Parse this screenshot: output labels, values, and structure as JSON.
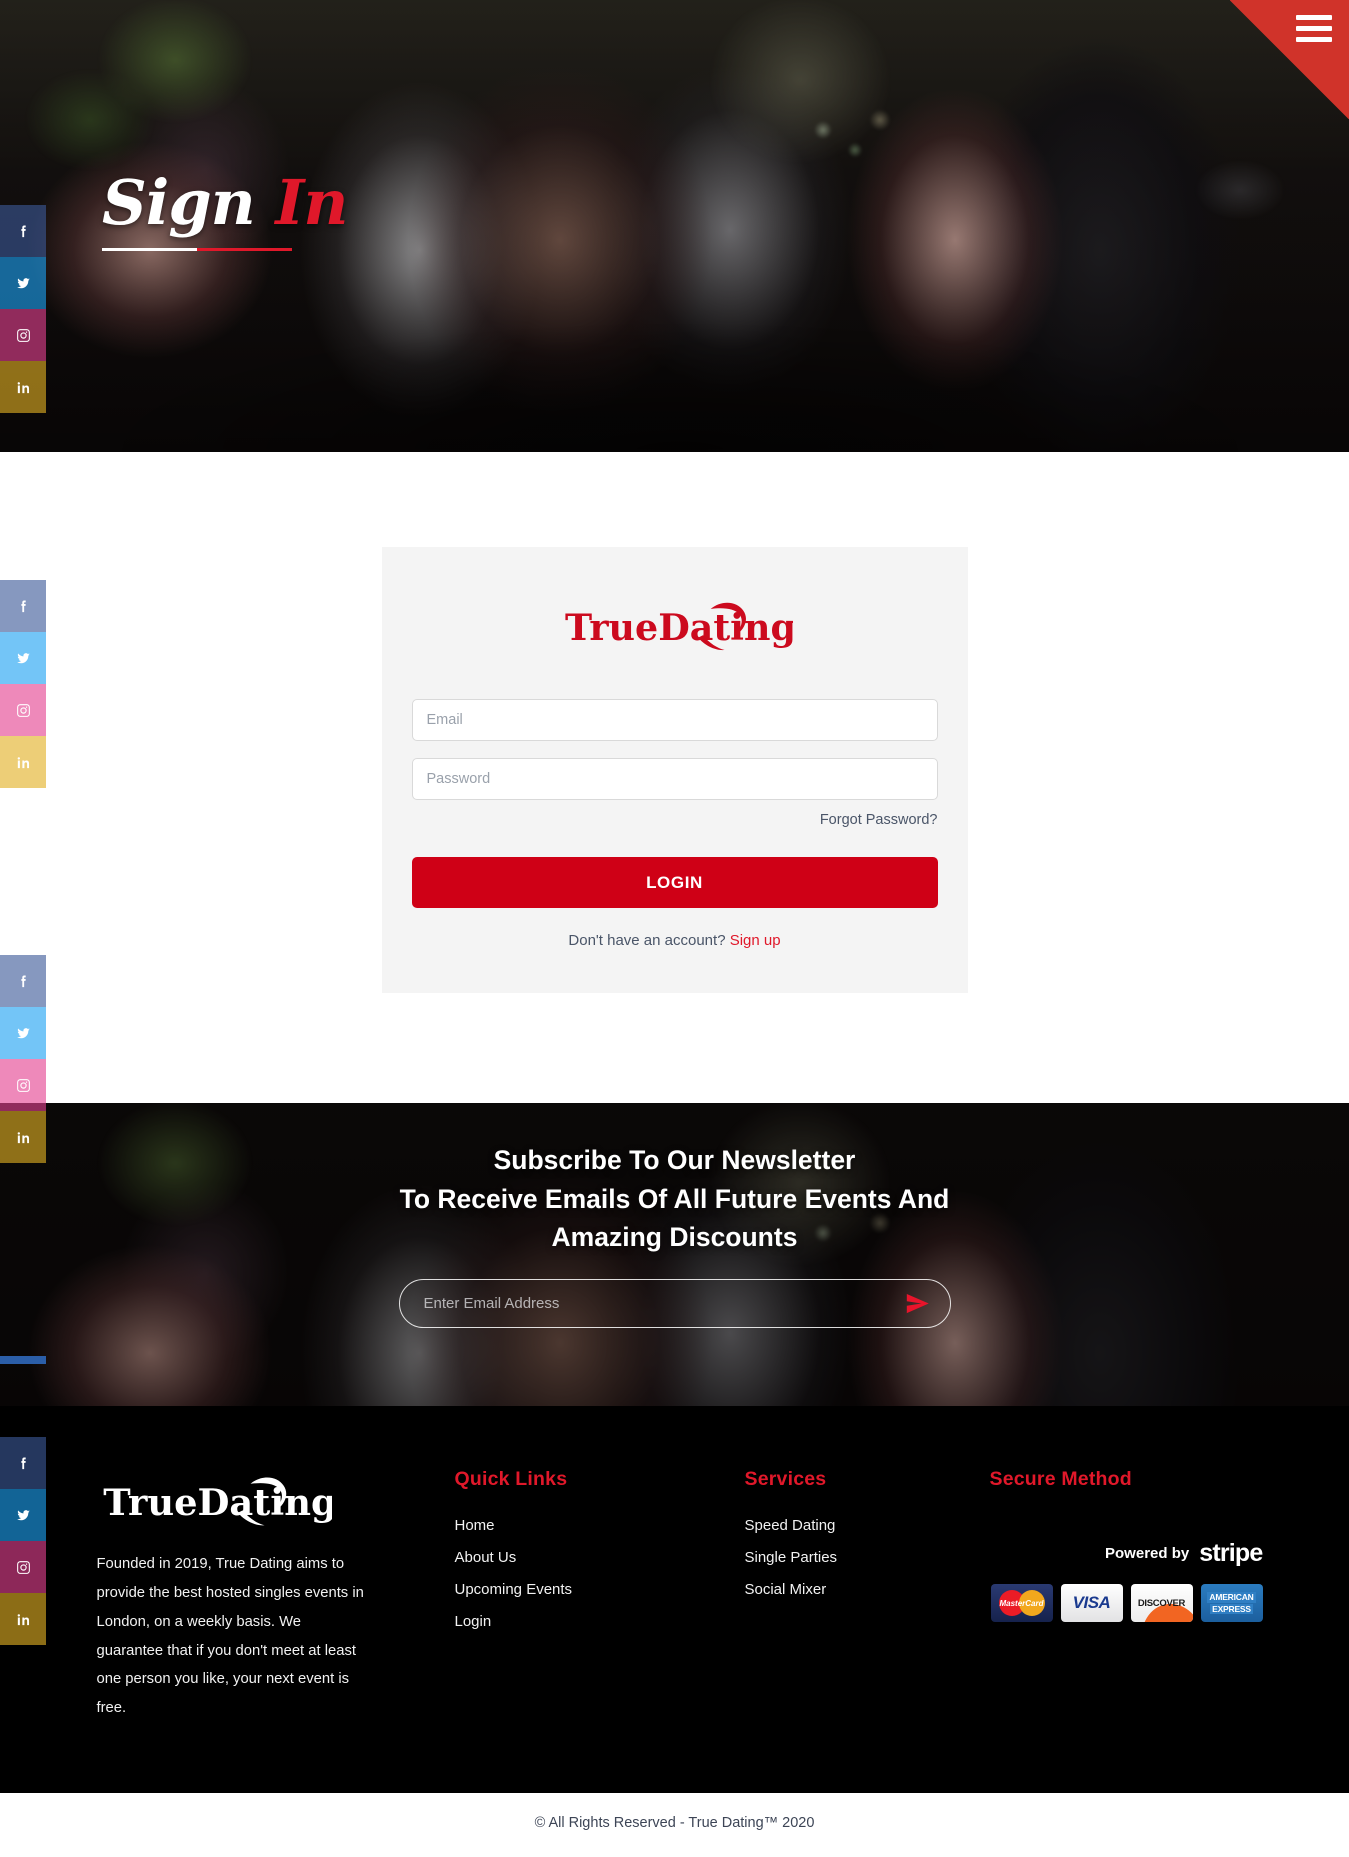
{
  "brand": {
    "name": "TrueDating",
    "accent_red": "#e0182a",
    "button_red": "#cf0016"
  },
  "header": {
    "menu_icon": "hamburger-menu-icon",
    "page_title_white": "Sign",
    "page_title_red": "In"
  },
  "social": {
    "facebook_label": "Facebook",
    "twitter_label": "Twitter",
    "instagram_label": "Instagram",
    "linkedin_label": "LinkedIn"
  },
  "login": {
    "logo_text": "TrueDating",
    "email_placeholder": "Email",
    "email_value": "",
    "password_placeholder": "Password",
    "password_value": "",
    "forgot_label": "Forgot Password?",
    "submit_label": "LOGIN",
    "signup_prompt": "Don't have an account?",
    "signup_link": "Sign up"
  },
  "newsletter": {
    "heading_line1": "Subscribe To Our Newsletter",
    "heading_line2": "To Receive Emails Of All Future Events And",
    "heading_line3": "Amazing Discounts",
    "email_placeholder": "Enter Email Address",
    "email_value": "",
    "send_icon": "paper-plane-icon"
  },
  "footer": {
    "logo_text": "TrueDating",
    "description": "Founded in 2019, True Dating aims to provide the best hosted singles events in London, on a weekly basis. We guarantee that if you don't meet at least one person you like, your next event is free.",
    "quick_links": {
      "title": "Quick Links",
      "items": [
        {
          "label": "Home"
        },
        {
          "label": "About Us"
        },
        {
          "label": "Upcoming Events"
        },
        {
          "label": "Login"
        }
      ]
    },
    "services": {
      "title": "Services",
      "items": [
        {
          "label": "Speed Dating"
        },
        {
          "label": "Single Parties"
        },
        {
          "label": "Social Mixer"
        }
      ]
    },
    "secure": {
      "title": "Secure Method",
      "powered_by": "Powered by",
      "provider": "stripe",
      "cards": [
        {
          "name": "MasterCard",
          "label": "MasterCard"
        },
        {
          "name": "Visa",
          "label": "VISA"
        },
        {
          "name": "Discover",
          "label": "DISCOVER"
        },
        {
          "name": "American Express",
          "label_line1": "AMERICAN",
          "label_line2": "EXPRESS"
        }
      ]
    }
  },
  "copyright": {
    "text": "© All Rights Reserved - True Dating™ 2020"
  }
}
